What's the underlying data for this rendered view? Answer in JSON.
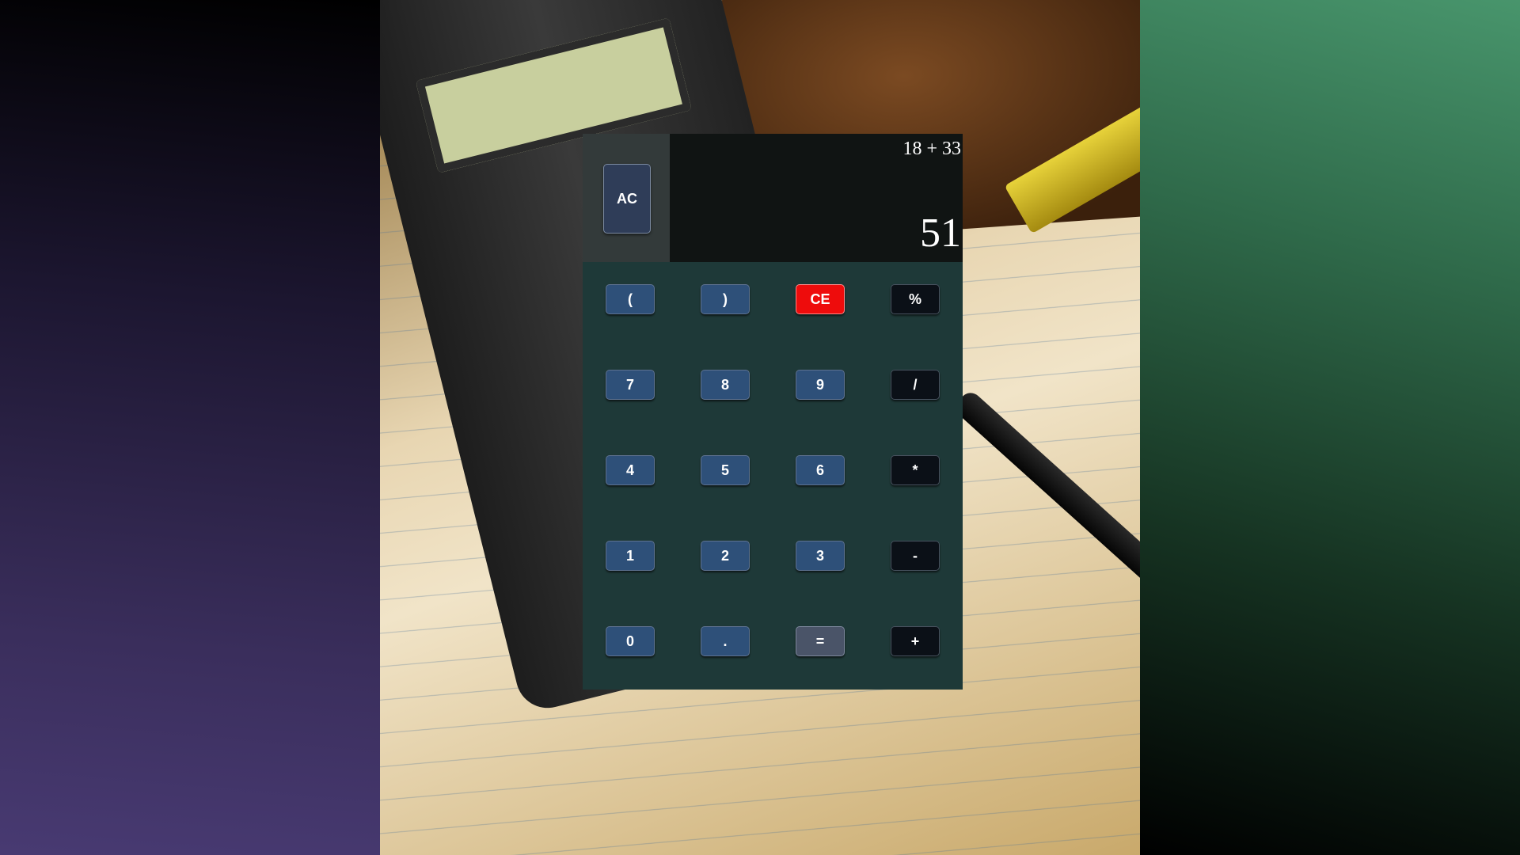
{
  "display": {
    "expression": "18 + 33",
    "result": "51"
  },
  "ac_button": "AC",
  "keys": {
    "open_paren": "(",
    "close_paren": ")",
    "ce": "CE",
    "percent": "%",
    "seven": "7",
    "eight": "8",
    "nine": "9",
    "divide": "/",
    "four": "4",
    "five": "5",
    "six": "6",
    "multiply": "*",
    "one": "1",
    "two": "2",
    "three": "3",
    "subtract": "-",
    "zero": "0",
    "decimal": ".",
    "equals": "=",
    "add": "+"
  },
  "colors": {
    "keypad_bg": "#1e3938",
    "number_key": "#2e5079",
    "operator_key": "#0b1017",
    "ce_key": "#ee0c0c",
    "equals_key": "#4a5468",
    "display_bg": "#101413",
    "ac_panel": "#333a3a"
  }
}
